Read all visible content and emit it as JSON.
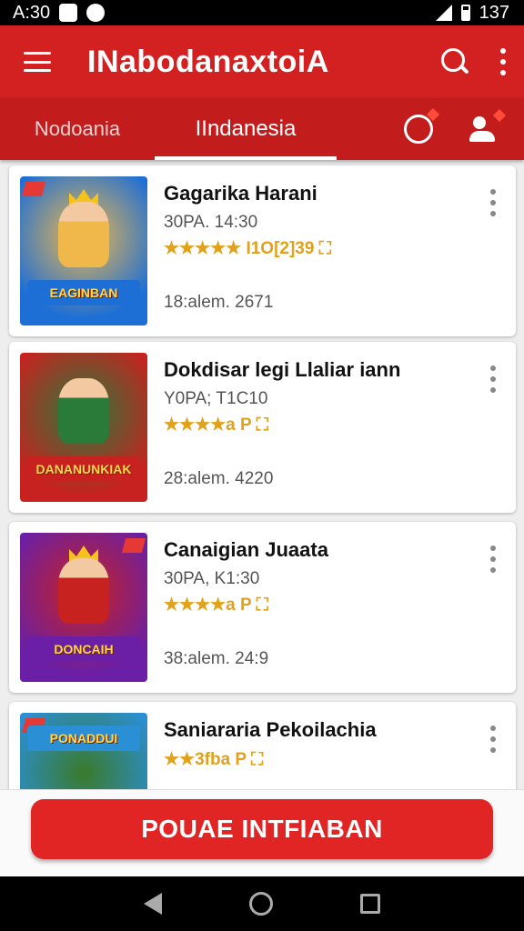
{
  "status_bar": {
    "time": "A:30",
    "battery": "137"
  },
  "app_bar": {
    "title": "INabodanaxtoiA"
  },
  "tabs": [
    {
      "label": "Nodoania"
    },
    {
      "label": "IIndanesia"
    }
  ],
  "items": [
    {
      "title": "Gagarika Harani",
      "meta": "30PA. 14:30",
      "rating": "★★★★★ I1O[2]39 ⛶",
      "footer": "18:alem. 2671",
      "banner": "EAGINBAN",
      "colors": [
        "#1d6fd6",
        "#f0b84a"
      ]
    },
    {
      "title": "Dokdisar legi Llaliar iann",
      "meta": "Y0PA; T1C10",
      "rating": "★★★★a P ⛶",
      "footer": "28:alem. 4220",
      "banner": "DANANUNKIAK",
      "colors": [
        "#c7221f",
        "#2a7a3a"
      ]
    },
    {
      "title": "Canaigian Juaata",
      "meta": "30PA, K1:30",
      "rating": "★★★★a P ⛶",
      "footer": "38:alem. 24:9",
      "banner": "DONCAIH",
      "colors": [
        "#6a1fa6",
        "#c7221f"
      ]
    },
    {
      "title": "Saniararia Pekoilachia",
      "meta": "",
      "rating": "★★3fba P ⛶",
      "footer": "",
      "banner": "PONADDUI",
      "colors": [
        "#2b8fd6",
        "#3a7a2a"
      ]
    }
  ],
  "cta": {
    "label": "POUAE INTFIABAN"
  },
  "colors": {
    "primary": "#d32121",
    "tab_bg": "#c21c1c",
    "star": "#e1a11a"
  }
}
